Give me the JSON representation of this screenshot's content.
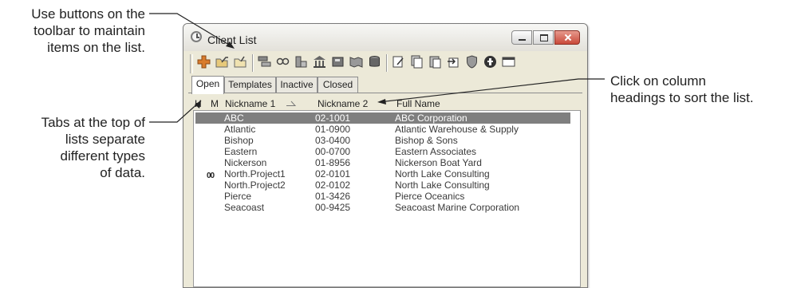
{
  "callouts": {
    "toolbar": [
      "Use buttons on the",
      "toolbar to maintain",
      "items on the list."
    ],
    "tabs": [
      "Tabs at the top of",
      "lists separate",
      "different types",
      "of data."
    ],
    "headings": [
      "Click on column",
      "headings to sort the list."
    ]
  },
  "window": {
    "title": "Client List",
    "icon": "clock-icon",
    "controls": [
      "minimize-icon",
      "maximize-icon",
      "close-icon"
    ]
  },
  "toolbar_icons": [
    "add-icon",
    "open-folder-icon",
    "edit-folder-icon",
    "transfer-icon",
    "find-icon",
    "report-icon",
    "bank-icon",
    "book-icon",
    "map-icon",
    "database-icon",
    "notes-icon",
    "copy-icon",
    "paste-icon",
    "export-icon",
    "shield-icon",
    "info-icon",
    "window-icon"
  ],
  "tabs": [
    "Open",
    "Templates",
    "Inactive",
    "Closed"
  ],
  "active_tab": "Open",
  "columns": {
    "h": "H",
    "m": "M",
    "nickname1": "Nickname 1",
    "nickname2": "Nickname 2",
    "fullname": "Full Name"
  },
  "sort": {
    "column": "Nickname 1",
    "direction": "ascending"
  },
  "rows": [
    {
      "badge": "",
      "nickname1": "ABC",
      "nickname2": "02-1001",
      "fullname": "ABC Corporation",
      "selected": true
    },
    {
      "badge": "",
      "nickname1": "Atlantic",
      "nickname2": "01-0900",
      "fullname": "Atlantic Warehouse & Supply",
      "selected": false
    },
    {
      "badge": "",
      "nickname1": "Bishop",
      "nickname2": "03-0400",
      "fullname": "Bishop & Sons",
      "selected": false
    },
    {
      "badge": "",
      "nickname1": "Eastern",
      "nickname2": "00-0700",
      "fullname": "Eastern Associates",
      "selected": false
    },
    {
      "badge": "",
      "nickname1": "Nickerson",
      "nickname2": "01-8956",
      "fullname": "Nickerson Boat Yard",
      "selected": false
    },
    {
      "badge": "00",
      "nickname1": "North.Project1",
      "nickname2": "02-0101",
      "fullname": "North Lake Consulting",
      "selected": false
    },
    {
      "badge": "",
      "nickname1": "North.Project2",
      "nickname2": "02-0102",
      "fullname": "North Lake Consulting",
      "selected": false
    },
    {
      "badge": "",
      "nickname1": "Pierce",
      "nickname2": "01-3426",
      "fullname": "Pierce Oceanics",
      "selected": false
    },
    {
      "badge": "",
      "nickname1": "Seacoast",
      "nickname2": "00-9425",
      "fullname": "Seacoast Marine Corporation",
      "selected": false
    }
  ],
  "colors": {
    "selection": "#7f7f7f",
    "window_bg": "#ece9d8",
    "close_button": "#c94a3a"
  }
}
